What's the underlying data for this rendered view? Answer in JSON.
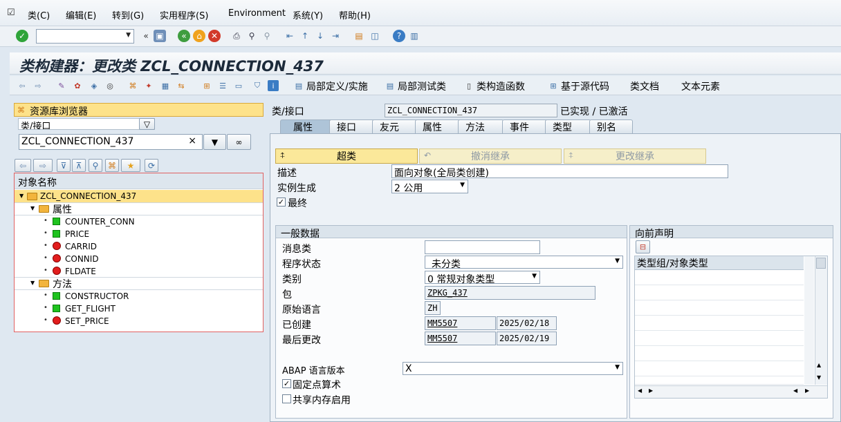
{
  "menu": {
    "items": [
      "类(C)",
      "编辑(E)",
      "转到(G)",
      "实用程序(S)",
      "Environment",
      "系统(Y)",
      "帮助(H)"
    ]
  },
  "title": "类构建器：更改类 ZCL_CONNECTION_437",
  "app_toolbar": {
    "local_def": "局部定义/实施",
    "local_test": "局部测试类",
    "constructor": "类构造函数",
    "source_based": "基于源代码",
    "class_doc": "类文档",
    "text_elements": "文本元素"
  },
  "repo_browser": {
    "title": "资源库浏览器",
    "object_type": "类/接口",
    "object_name": "ZCL_CONNECTION_437",
    "tree_header": "对象名称",
    "root": "ZCL_CONNECTION_437",
    "attributes_label": "属性",
    "attributes": [
      "COUNTER_CONN",
      "PRICE",
      "CARRID",
      "CONNID",
      "FLDATE"
    ],
    "methods_label": "方法",
    "methods": [
      "CONSTRUCTOR",
      "GET_FLIGHT",
      "SET_PRICE"
    ]
  },
  "header": {
    "class_label": "类/接口",
    "class_value": "ZCL_CONNECTION_437",
    "status": "已实现 / 已激活"
  },
  "tabs": [
    "属性",
    "接口",
    "友元",
    "属性",
    "方法",
    "事件",
    "类型",
    "别名"
  ],
  "props": {
    "superclass_btn": "超类",
    "undo_inherit_btn": "撤消继承",
    "change_inherit_btn": "更改继承",
    "desc_label": "描述",
    "desc_value": "面向对象(全局类创建)",
    "inst_label": "实例生成",
    "inst_value": "2 公用",
    "final_label": "最终"
  },
  "general": {
    "title": "一般数据",
    "msg_class_label": "消息类",
    "prog_status_label": "程序状态",
    "prog_status_value": "未分类",
    "category_label": "类别",
    "category_value": "0 常规对象类型",
    "package_label": "包",
    "package_value": "ZPKG_437",
    "orig_lang_label": "原始语言",
    "orig_lang_value": "ZH",
    "created_label": "已创建",
    "created_user": "MM5507",
    "created_date": "2025/02/18",
    "changed_label": "最后更改",
    "changed_user": "MM5507",
    "changed_date": "2025/02/19",
    "abap_ver_label": "ABAP 语言版本",
    "abap_ver_value": "X",
    "fixed_point_label": "固定点算术",
    "shared_mem_label": "共享内存启用"
  },
  "forward": {
    "title": "向前声明",
    "col_header": "类型组/对象类型"
  }
}
